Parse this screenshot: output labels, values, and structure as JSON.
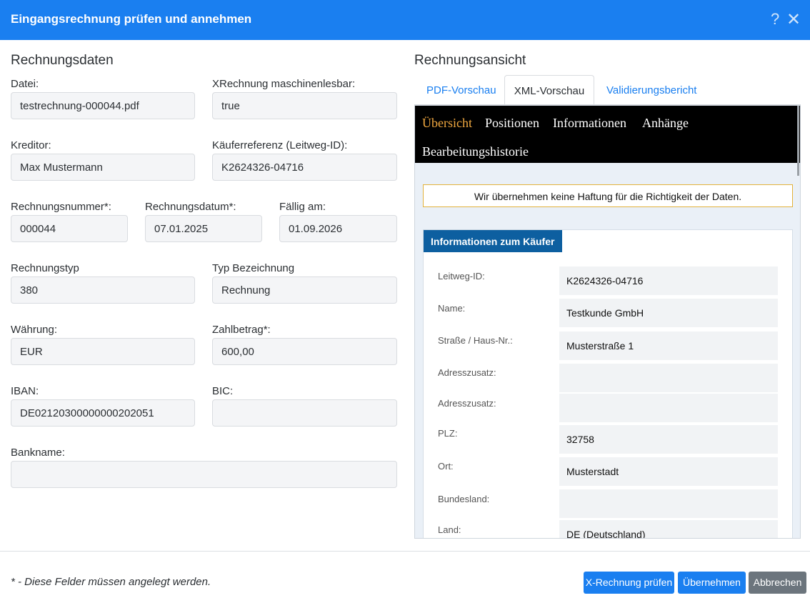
{
  "dialog": {
    "title": "Eingangsrechnung prüfen und annehmen",
    "help_icon": "?",
    "close_icon": "✕"
  },
  "invoice_data": {
    "section_title": "Rechnungsdaten",
    "file": {
      "label": "Datei:",
      "value": "testrechnung-000044.pdf"
    },
    "xrechnung": {
      "label": "XRechnung maschinenlesbar:",
      "value": "true"
    },
    "creditor": {
      "label": "Kreditor:",
      "value": "Max Mustermann"
    },
    "buyer_reference": {
      "label": "Käuferreferenz (Leitweg-ID):",
      "value": "K2624326-04716"
    },
    "invoice_number": {
      "label": "Rechnungsnummer*:",
      "value": "000044"
    },
    "invoice_date": {
      "label": "Rechnungsdatum*:",
      "value": "07.01.2025"
    },
    "due_date": {
      "label": "Fällig am:",
      "value": "01.09.2026"
    },
    "invoice_type": {
      "label": "Rechnungstyp",
      "value": "380"
    },
    "type_name": {
      "label": "Typ Bezeichnung",
      "value": "Rechnung"
    },
    "currency": {
      "label": "Währung:",
      "value": "EUR"
    },
    "amount": {
      "label": "Zahlbetrag*:",
      "value": "600,00"
    },
    "iban": {
      "label": "IBAN:",
      "value": "DE02120300000000202051"
    },
    "bic": {
      "label": "BIC:",
      "value": ""
    },
    "bank_name": {
      "label": "Bankname:",
      "value": ""
    }
  },
  "invoice_view": {
    "section_title": "Rechnungsansicht",
    "tabs": [
      {
        "label": "PDF-Vorschau",
        "active": false
      },
      {
        "label": "XML-Vorschau",
        "active": true
      },
      {
        "label": "Validierungsbericht",
        "active": false
      }
    ],
    "nav": [
      "Übersicht",
      "Positionen",
      "Informationen",
      "Anhänge",
      "Bearbeitungshistorie"
    ],
    "disclaimer": "Wir übernehmen keine Haftung für die Richtigkeit der Daten.",
    "buyer_card": {
      "title": "Informationen zum Käufer",
      "rows": [
        {
          "label": "Leitweg-ID:",
          "value": "K2624326-04716"
        },
        {
          "label": "Name:",
          "value": "Testkunde GmbH"
        },
        {
          "label": "Straße / Haus-Nr.:",
          "value": "Musterstraße 1"
        },
        {
          "label": "Adresszusatz:",
          "value": ""
        },
        {
          "label": "Adresszusatz:",
          "value": ""
        },
        {
          "label": "PLZ:",
          "value": "32758"
        },
        {
          "label": "Ort:",
          "value": "Musterstadt"
        },
        {
          "label": "Bundesland:",
          "value": ""
        },
        {
          "label": "Land:",
          "value": "DE (Deutschland)"
        }
      ]
    }
  },
  "footer": {
    "note": "* - Diese Felder müssen angelegt werden.",
    "check_button": "X-Rechnung prüfen",
    "accept_button": "Übernehmen",
    "cancel_button": "Abbrechen"
  },
  "colors": {
    "accent": "#1a7ff0",
    "nav_highlight": "#f0a840",
    "card_header": "#0d5fa0"
  }
}
